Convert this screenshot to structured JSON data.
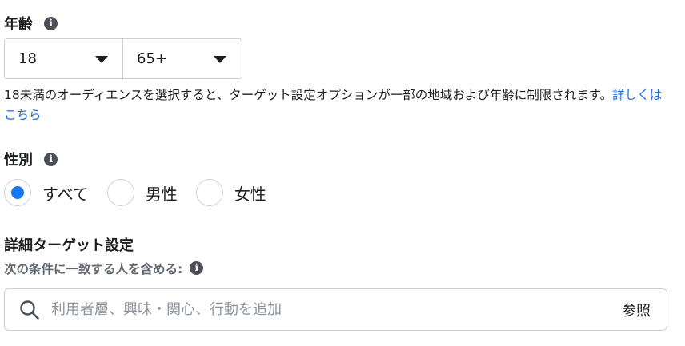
{
  "age": {
    "heading": "年齢",
    "min_value": "18",
    "max_value": "65+",
    "help_text": "18未満のオーディエンスを選択すると、ターゲット設定オプションが一部の地域および年齢に制限されます。",
    "help_link": "詳しくはこちら"
  },
  "gender": {
    "heading": "性別",
    "options": [
      {
        "label": "すべて",
        "selected": true
      },
      {
        "label": "男性",
        "selected": false
      },
      {
        "label": "女性",
        "selected": false
      }
    ]
  },
  "detailed_targeting": {
    "heading": "詳細ターゲット設定",
    "sub_label": "次の条件に一致する人を含める:",
    "search_placeholder": "利用者層、興味・関心、行動を追加",
    "browse_label": "参照"
  },
  "icons": {
    "info": "info-icon",
    "dropdown": "caret-down-icon",
    "search": "search-icon"
  },
  "colors": {
    "accent": "#1877f2",
    "link": "#216fdb",
    "border": "#ccd0d5",
    "muted_text": "#606770"
  }
}
